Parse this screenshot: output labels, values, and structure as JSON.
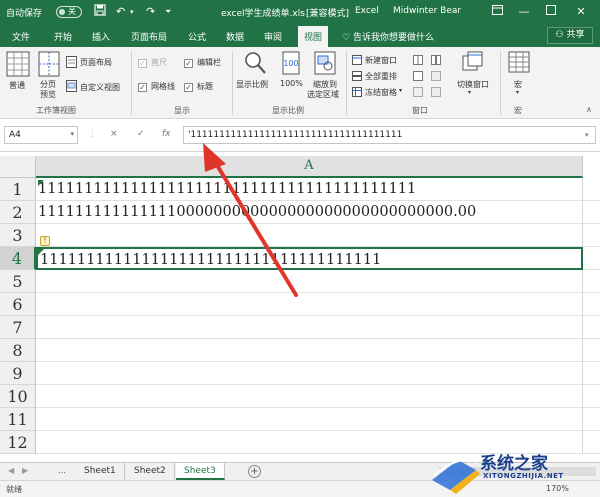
{
  "titlebar": {
    "autosave_label": "自动保存",
    "autosave_state": "关",
    "filename": "excel学生成绩单.xls",
    "mode": "[兼容模式]",
    "app": "Excel",
    "user": "Midwinter Bear"
  },
  "tabs": [
    "文件",
    "开始",
    "插入",
    "页面布局",
    "公式",
    "数据",
    "审阅",
    "视图"
  ],
  "active_tab": "视图",
  "tellme": "告诉我你想要做什么",
  "share_label": "共享",
  "ribbon": {
    "groups": {
      "workbook_views": "工作簿视图",
      "show": "显示",
      "zoom": "显示比例",
      "window": "窗口",
      "macros": "宏"
    },
    "normal": "普通",
    "page_break_line1": "分页",
    "page_break_line2": "预览",
    "page_layout": "页面布局",
    "custom_views": "自定义视图",
    "ruler": "直尺",
    "formula_bar": "编辑栏",
    "gridlines": "网格线",
    "headings": "标题",
    "zoom_label": "显示比例",
    "zoom_100": "100%",
    "zoom_sel_line1": "缩放到",
    "zoom_sel_line2": "选定区域",
    "new_window": "新建窗口",
    "arrange_all": "全部重排",
    "freeze_panes": "冻结窗格",
    "switch_windows": "切换窗口",
    "macros_label": "宏"
  },
  "formula_bar": {
    "name_box": "A4",
    "cancel": "×",
    "enter": "✓",
    "fx": "fx",
    "content": "'1111111111111111111111111111111111111"
  },
  "sheet": {
    "column": "A",
    "rows": [
      "1",
      "2",
      "3",
      "4",
      "5",
      "6",
      "7",
      "8",
      "9",
      "10",
      "11",
      "12"
    ],
    "cells": [
      "11111111111111111111111111111111111111111",
      "111111111111111000000000000000000000000000000.00",
      "",
      "1111111111111111111111111111111111111",
      "",
      "",
      "",
      "",
      "",
      "",
      "",
      ""
    ],
    "active_cell": "A4"
  },
  "sheet_tabs": [
    "Sheet1",
    "Sheet2",
    "Sheet3"
  ],
  "active_sheet": "Sheet3",
  "add_sheet": "+",
  "status": {
    "ready": "就绪",
    "zoom": "170%"
  },
  "watermark": {
    "text": "系统之家",
    "url": "XITONGZHIJIA.NET"
  },
  "colors": {
    "excel_green": "#217346",
    "arrow": "#e0352b",
    "watermark_blue": "#1b3f8c"
  }
}
